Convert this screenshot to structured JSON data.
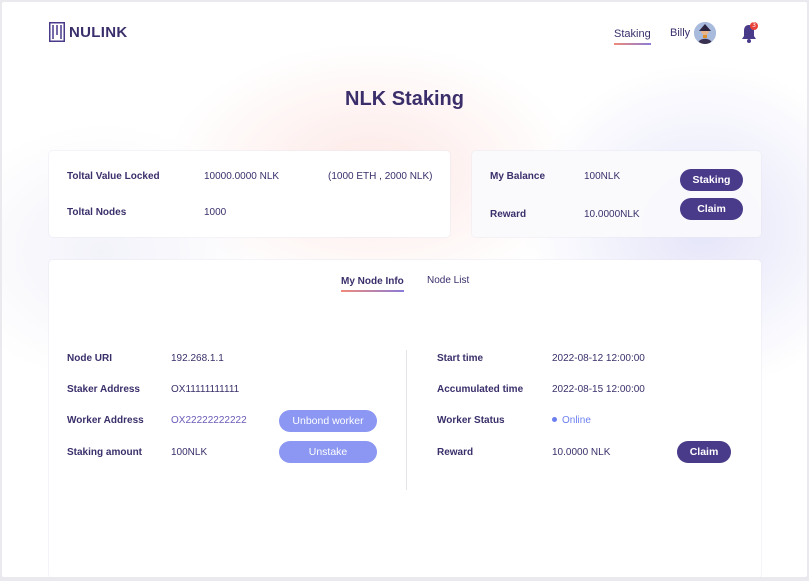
{
  "header": {
    "logo_text": "NULINK",
    "nav_staking": "Staking",
    "user_name": "Billy",
    "notification_count": "3"
  },
  "page_title": "NLK Staking",
  "summary": {
    "tvl_label": "Toltal Value Locked",
    "tvl_value": "10000.0000 NLK",
    "tvl_breakdown": "(1000 ETH , 2000 NLK)",
    "nodes_label": "Toltal Nodes",
    "nodes_value": "1000"
  },
  "balance": {
    "balance_label": "My Balance",
    "balance_value": "100NLK",
    "reward_label": "Reward",
    "reward_value": "10.0000NLK",
    "staking_button": "Staking",
    "claim_button": "Claim"
  },
  "tabs": [
    {
      "label": "My Node Info",
      "active": true
    },
    {
      "label": "Node List",
      "active": false
    }
  ],
  "node_info": {
    "left": [
      {
        "label": "Node URI",
        "value": "192.268.1.1"
      },
      {
        "label": "Staker Address",
        "value": "OX11111111111"
      },
      {
        "label": "Worker Address",
        "value": "OX22222222222"
      },
      {
        "label": "Staking amount",
        "value": "100NLK"
      }
    ],
    "right": [
      {
        "label": "Start time",
        "value": "2022-08-12 12:00:00"
      },
      {
        "label": "Accumulated  time",
        "value": "2022-08-15 12:00:00"
      },
      {
        "label": "Worker Status",
        "value": "Online"
      },
      {
        "label": "Reward",
        "value": "10.0000 NLK"
      }
    ],
    "unbond_button": "Unbond worker",
    "unstake_button": "Unstake",
    "claim_button": "Claim"
  },
  "colors": {
    "primary_dark": "#4a3a8a",
    "primary_light": "#8b97f2",
    "text": "#3b2f6b",
    "online": "#6c7ff0",
    "badge": "#e8413a"
  },
  "icons": {
    "logo": "nulink-logo-icon",
    "avatar": "user-avatar",
    "bell": "bell-icon",
    "status": "status-dot-icon"
  }
}
